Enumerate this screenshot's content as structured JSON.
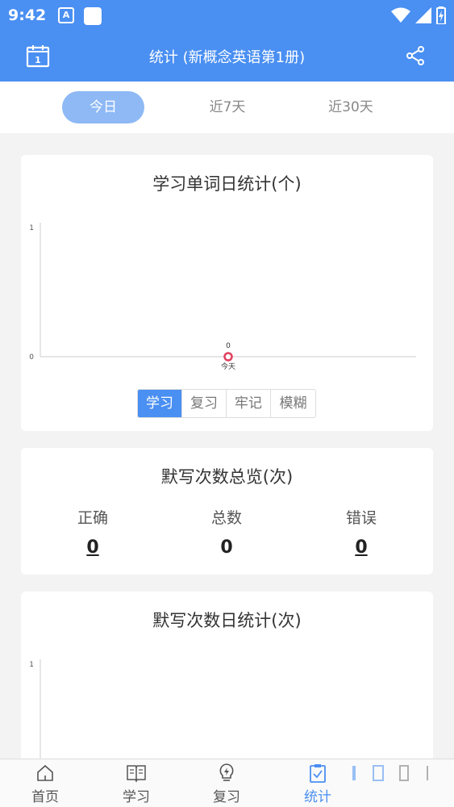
{
  "status_bar": {
    "time": "9:42",
    "left_icons": [
      "a-notification-icon",
      "app-notification-icon"
    ],
    "right_icons": [
      "wifi-icon",
      "signal-icon",
      "battery-icon"
    ]
  },
  "app_bar": {
    "title": "统计 (新概念英语第1册)",
    "left_icon": "calendar-icon",
    "calendar_day": "1",
    "right_icon": "share-icon"
  },
  "range_tabs": [
    {
      "label": "今日",
      "active": true
    },
    {
      "label": "近7天",
      "active": false
    },
    {
      "label": "近30天",
      "active": false
    }
  ],
  "word_stats": {
    "title": "学习单词日统计(个)",
    "segments": [
      {
        "label": "学习",
        "active": true
      },
      {
        "label": "复习",
        "active": false
      },
      {
        "label": "牢记",
        "active": false
      },
      {
        "label": "模糊",
        "active": false
      }
    ]
  },
  "dictation_summary": {
    "title": "默写次数总览(次)",
    "columns": [
      {
        "label": "正确",
        "value": "0",
        "link": true
      },
      {
        "label": "总数",
        "value": "0",
        "link": false
      },
      {
        "label": "错误",
        "value": "0",
        "link": true
      }
    ]
  },
  "dictation_daily": {
    "title": "默写次数日统计(次)"
  },
  "chart_data": [
    {
      "type": "line",
      "categories": [
        "今天"
      ],
      "values": [
        0
      ],
      "data_labels": [
        "0"
      ],
      "yticks": [
        "1",
        "0"
      ],
      "ylim": [
        0,
        1
      ],
      "grid": false,
      "marker_color": "#e0405e"
    },
    {
      "type": "line",
      "categories": [],
      "values": [],
      "yticks": [
        "1"
      ],
      "ylim": [
        0,
        1
      ]
    }
  ],
  "bottom_nav": [
    {
      "label": "首页",
      "icon": "home-icon",
      "active": false
    },
    {
      "label": "学习",
      "icon": "book-icon",
      "active": false
    },
    {
      "label": "复习",
      "icon": "lightbulb-icon",
      "active": false
    },
    {
      "label": "统计",
      "icon": "clipboard-check-icon",
      "active": true
    }
  ],
  "colors": {
    "primary": "#4a8ff2",
    "tab_active": "#8eb9f5",
    "marker": "#e0405e"
  }
}
